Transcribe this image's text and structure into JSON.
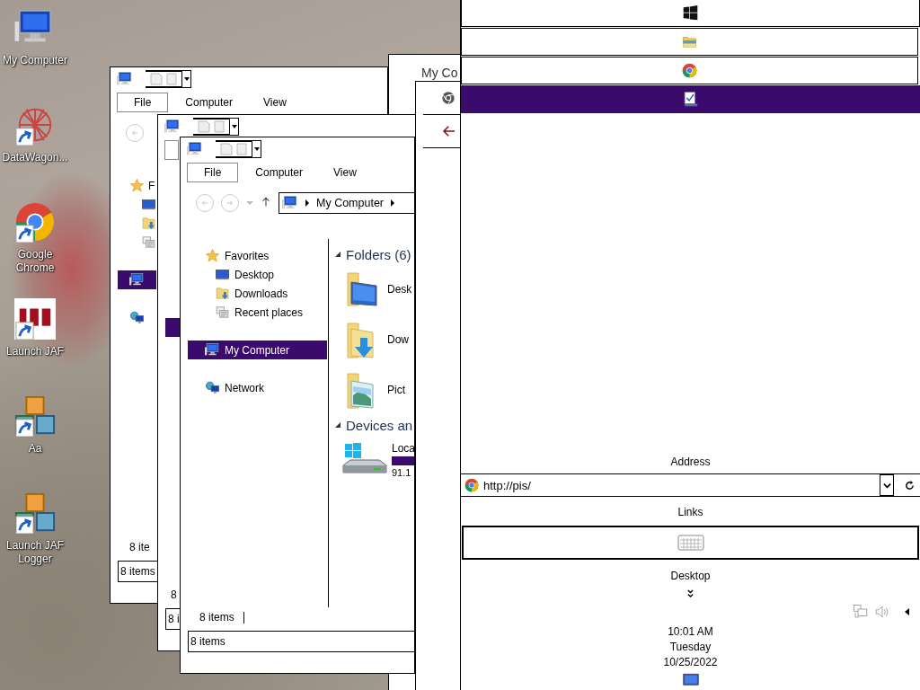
{
  "desktop_icons": [
    {
      "label": "My Computer",
      "kind": "computer"
    },
    {
      "label": "DataWagon...",
      "kind": "starburst"
    },
    {
      "label": "Google Chrome",
      "kind": "chrome"
    },
    {
      "label": "Launch JAF",
      "kind": "jaf"
    },
    {
      "label": "Aa",
      "kind": "blocks"
    },
    {
      "label": "Launch JAF Logger",
      "kind": "blocks"
    }
  ],
  "behind_window": {
    "title": "My Co"
  },
  "explorer_windows": [
    {
      "ribbon_tabs": [
        {
          "label": "File",
          "selected": true
        },
        {
          "label": "Computer",
          "selected": false
        },
        {
          "label": "View",
          "selected": false
        }
      ],
      "back_button": true,
      "nav_pane": {
        "favorites": {
          "label": "F",
          "items": [
            {
              "kind": "desktop"
            },
            {
              "kind": "downloads"
            },
            {
              "kind": "recent"
            }
          ]
        },
        "computer": {
          "selected": true
        },
        "network": {
          "selected": false
        }
      },
      "status_text": "8 ite",
      "status_bar": "8 items"
    },
    {
      "ribbon_tabs": [
        {
          "selected": true
        }
      ],
      "nav_pane": {
        "computer": {
          "selected": true
        }
      },
      "status_text": "8",
      "status_bar": "8 i"
    },
    {
      "ribbon_tabs": [
        {
          "label": "File",
          "selected": true
        },
        {
          "label": "Computer",
          "selected": false
        },
        {
          "label": "View",
          "selected": false
        }
      ],
      "breadcrumb": "My Computer",
      "nav_pane": {
        "favorites": {
          "label": "Favorites",
          "items": [
            {
              "kind": "desktop",
              "label": "Desktop"
            },
            {
              "kind": "downloads",
              "label": "Downloads"
            },
            {
              "kind": "recent",
              "label": "Recent places"
            }
          ]
        },
        "computer": {
          "label": "My Computer",
          "selected": true
        },
        "network": {
          "label": "Network"
        }
      },
      "content": [
        {
          "heading": "Folders (6)",
          "items": [
            {
              "kind": "desktop-folder",
              "name": "Desk"
            },
            {
              "kind": "downloads-folder",
              "name": "Dow"
            },
            {
              "kind": "pictures-folder",
              "name": "Pict"
            }
          ]
        },
        {
          "heading": "Devices an",
          "items": [
            {
              "kind": "drive",
              "name": "Loca",
              "level": 0.6,
              "detail": "91.1"
            }
          ]
        }
      ],
      "status_text": "8 items",
      "status_bar": "8 items"
    }
  ],
  "taskbar": {
    "buttons": [
      {
        "kind": "start",
        "selected": false
      },
      {
        "kind": "explorer",
        "selected": false
      },
      {
        "kind": "chrome",
        "selected": false
      },
      {
        "kind": "app",
        "selected": true
      }
    ],
    "address_toolbar": {
      "label": "Address",
      "value": "http://pis/"
    },
    "links_toolbar": {
      "label": "Links"
    },
    "desktop_toolbar": {
      "label": "Desktop"
    },
    "clock": [
      "10:01 AM",
      "Tuesday",
      "10/25/2022"
    ]
  }
}
